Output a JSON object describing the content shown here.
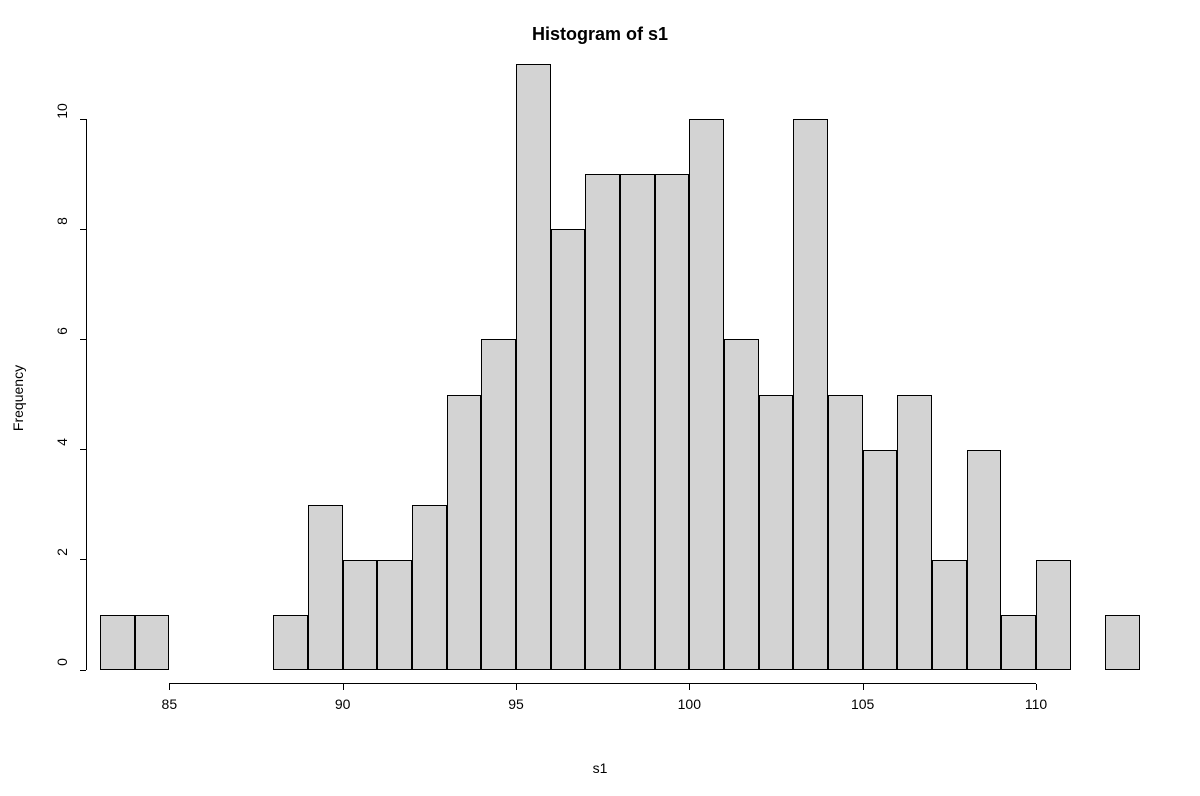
{
  "chart_data": {
    "type": "bar",
    "title": "Histogram of s1",
    "xlabel": "s1",
    "ylabel": "Frequency",
    "x_range": [
      83,
      113
    ],
    "bin_width": 1,
    "bin_edges": [
      83,
      84,
      85,
      86,
      87,
      88,
      89,
      90,
      91,
      92,
      93,
      94,
      95,
      96,
      97,
      98,
      99,
      100,
      101,
      102,
      103,
      104,
      105,
      106,
      107,
      108,
      109,
      110,
      111,
      112,
      113
    ],
    "values": [
      1,
      1,
      0,
      0,
      0,
      1,
      3,
      2,
      2,
      3,
      5,
      6,
      11,
      8,
      9,
      9,
      9,
      10,
      6,
      5,
      10,
      5,
      4,
      5,
      2,
      4,
      1,
      2,
      0,
      1
    ],
    "y_ticks": [
      0,
      2,
      4,
      6,
      8,
      10
    ],
    "x_ticks": [
      85,
      90,
      95,
      100,
      105,
      110
    ],
    "colors": {
      "bar_fill": "#d3d3d3",
      "bar_stroke": "#000000"
    }
  }
}
